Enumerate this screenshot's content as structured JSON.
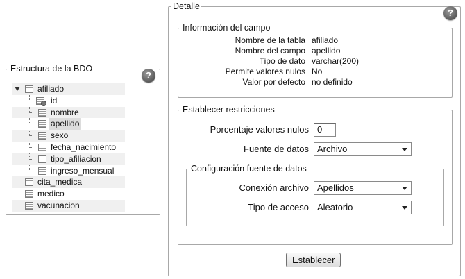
{
  "left_panel": {
    "legend": "Estructura de la BDO",
    "help": "?",
    "tree": [
      {
        "label": "afiliado",
        "level": 0,
        "expanded": true
      },
      {
        "label": "id",
        "level": 1,
        "icon": "key-field-icon"
      },
      {
        "label": "nombre",
        "level": 1,
        "icon": "table-icon"
      },
      {
        "label": "apellido",
        "level": 1,
        "icon": "table-icon",
        "selected": true
      },
      {
        "label": "sexo",
        "level": 1,
        "icon": "table-icon"
      },
      {
        "label": "fecha_nacimiento",
        "level": 1,
        "icon": "table-icon"
      },
      {
        "label": "tipo_afiliacion",
        "level": 1,
        "icon": "table-icon"
      },
      {
        "label": "ingreso_mensual",
        "level": 1,
        "icon": "table-icon"
      },
      {
        "label": "cita_medica",
        "level": 0
      },
      {
        "label": "medico",
        "level": 0
      },
      {
        "label": "vacunacion",
        "level": 0
      }
    ]
  },
  "detail": {
    "legend": "Detalle",
    "help": "?",
    "info": {
      "legend": "Información del campo",
      "rows": [
        {
          "label": "Nombre de la tabla",
          "value": "afiliado"
        },
        {
          "label": "Nombre del campo",
          "value": "apellido"
        },
        {
          "label": "Tipo de dato",
          "value": "varchar(200)"
        },
        {
          "label": "Permite valores nulos",
          "value": "No"
        },
        {
          "label": "Valor por defecto",
          "value": "no definido"
        }
      ]
    },
    "restrictions": {
      "legend": "Establecer restricciones",
      "null_pct_label": "Porcentaje valores nulos",
      "null_pct_value": "0",
      "source_label": "Fuente de datos",
      "source_value": "Archivo",
      "config": {
        "legend": "Configuración fuente de datos",
        "conn_label": "Conexión archivo",
        "conn_value": "Apellidos",
        "access_label": "Tipo de acceso",
        "access_value": "Aleatorio"
      }
    },
    "submit_label": "Establecer"
  }
}
